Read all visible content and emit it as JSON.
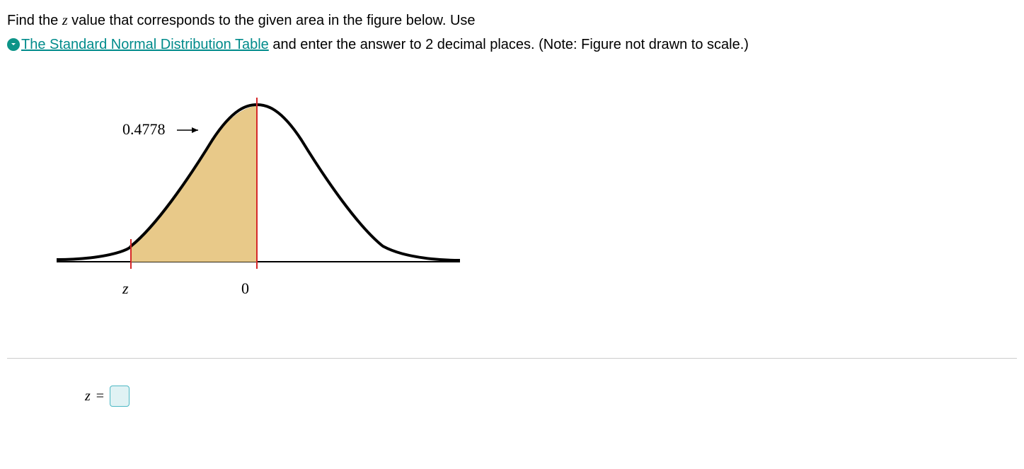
{
  "question": {
    "part1": "Find the ",
    "var1": "z",
    "part2": " value that corresponds to the given area in the figure below. Use ",
    "link_text": "The Standard Normal Distribution Table",
    "part3": " and enter the answer to 2 decimal places. (Note: Figure not drawn to scale.)"
  },
  "figure": {
    "area_label": "0.4778",
    "center_label": "0",
    "left_label": "z"
  },
  "answer": {
    "label_var": "z",
    "equals": "="
  },
  "chart_data": {
    "type": "area",
    "title": "Standard Normal Distribution",
    "shaded_area": 0.4778,
    "shaded_region": "from z (negative) to 0",
    "x_markers": [
      "z",
      "0"
    ],
    "note": "Area between negative z and the mean (0) = 0.4778"
  }
}
